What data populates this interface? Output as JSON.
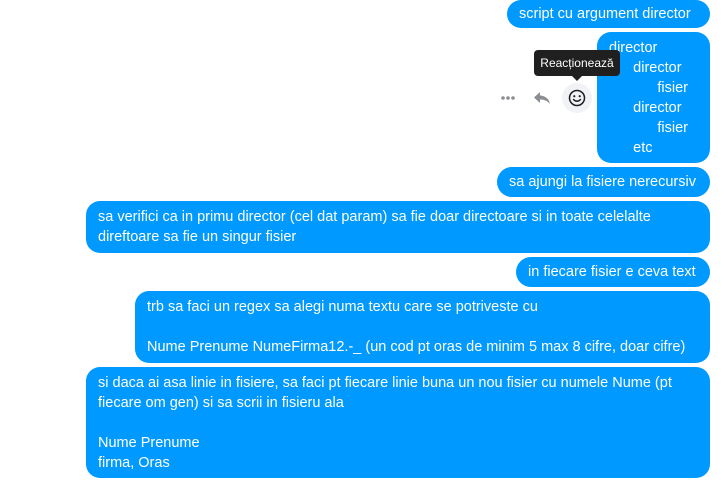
{
  "messages": [
    {
      "lines": [
        "script cu argument director"
      ]
    },
    {
      "lines": [
        "director",
        "      director",
        "            fisier",
        "      director",
        "            fisier",
        "      etc"
      ]
    },
    {
      "lines": [
        "sa ajungi la fisiere nerecursiv"
      ]
    },
    {
      "lines": [
        "sa verifici ca in primu director (cel dat param) sa fie doar directoare si in toate celelalte",
        "direftoare sa fie un singur fisier"
      ]
    },
    {
      "lines": [
        "in fiecare fisier e ceva text"
      ]
    },
    {
      "lines": [
        "trb sa faci un regex sa alegi numa textu care se potriveste cu",
        "",
        "Nume Prenume NumeFirma12.-_ (un cod pt oras de minim 5 max 8 cifre, doar cifre)"
      ]
    },
    {
      "lines": [
        "si daca ai asa linie in fisiere, sa faci pt fiecare linie buna un nou fisier cu numele Nume (pt",
        "fiecare om gen) si sa scrii in fisieru ala",
        "",
        "Nume Prenume",
        "firma, Oras"
      ]
    }
  ],
  "tooltip": {
    "label": "Reacționează"
  },
  "actions": {
    "more_icon": "more-icon",
    "reply_icon": "reply-icon",
    "react_icon": "smiley-icon"
  },
  "colors": {
    "bubble": "#0099ff",
    "tooltip": "#202020"
  }
}
